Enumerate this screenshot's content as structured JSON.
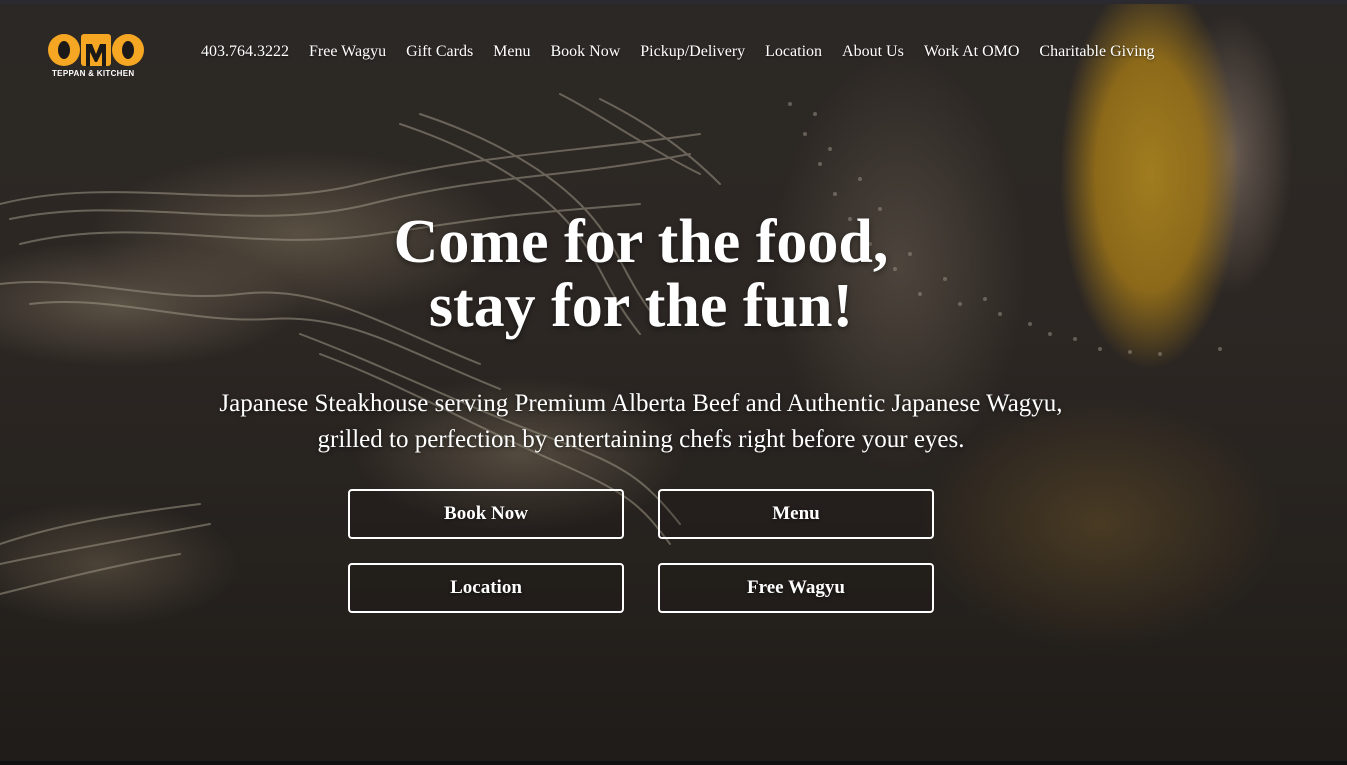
{
  "brand": {
    "logo_text": "OMO",
    "logo_subtitle": "TEPPAN & KITCHEN",
    "accent_color": "#f5a623"
  },
  "nav": {
    "items": [
      {
        "label": "403.764.3222"
      },
      {
        "label": "Free Wagyu"
      },
      {
        "label": "Gift Cards"
      },
      {
        "label": "Menu"
      },
      {
        "label": "Book Now"
      },
      {
        "label": "Pickup/Delivery"
      },
      {
        "label": "Location"
      },
      {
        "label": "About Us"
      },
      {
        "label": "Work At OMO"
      },
      {
        "label": "Charitable Giving"
      }
    ]
  },
  "hero": {
    "title_line1": "Come for the food,",
    "title_line2": "stay for the fun!",
    "subtitle_line1": "Japanese Steakhouse serving Premium Alberta Beef and Authentic Japanese Wagyu,",
    "subtitle_line2": "grilled to perfection by entertaining chefs right before your eyes.",
    "buttons": {
      "book_now": "Book Now",
      "menu": "Menu",
      "location": "Location",
      "free_wagyu": "Free Wagyu"
    }
  }
}
